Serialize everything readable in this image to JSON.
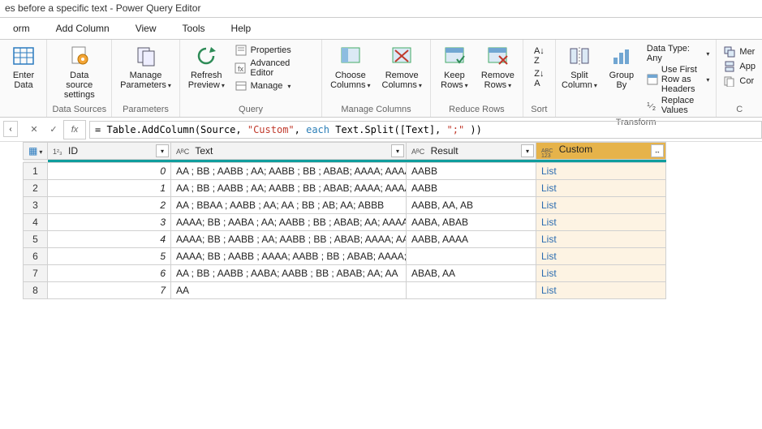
{
  "window": {
    "title": "es before a specific text - Power Query Editor"
  },
  "menus": [
    "orm",
    "Add Column",
    "View",
    "Tools",
    "Help"
  ],
  "ribbon": {
    "close": {
      "enter_data": "Enter\nData"
    },
    "data_sources": {
      "label": "Data Sources",
      "data_source_settings": "Data source\nsettings"
    },
    "parameters": {
      "label": "Parameters",
      "manage_parameters": "Manage\nParameters"
    },
    "query": {
      "label": "Query",
      "refresh_preview": "Refresh\nPreview",
      "properties": "Properties",
      "advanced_editor": "Advanced Editor",
      "manage": "Manage"
    },
    "manage_columns": {
      "label": "Manage Columns",
      "choose_columns": "Choose\nColumns",
      "remove_columns": "Remove\nColumns"
    },
    "reduce_rows": {
      "label": "Reduce Rows",
      "keep_rows": "Keep\nRows",
      "remove_rows": "Remove\nRows"
    },
    "sort": {
      "label": "Sort"
    },
    "transform": {
      "label": "Transform",
      "split_column": "Split\nColumn",
      "group_by": "Group\nBy",
      "data_type": "Data Type: Any",
      "first_row_headers": "Use First Row as Headers",
      "replace_values": "Replace Values"
    },
    "overflow": {
      "mer": "Mer",
      "app": "App",
      "cor": "Cor"
    }
  },
  "formula": {
    "prefix": "= Table.AddColumn(Source, ",
    "literal": "\"Custom\"",
    "mid1": ", ",
    "kw": "each",
    "mid2": " Text.Split([Text], ",
    "literal2": "\";\"",
    "suffix": " ))"
  },
  "grid": {
    "columns": {
      "id": "ID",
      "text": "Text",
      "result": "Result",
      "custom": "Custom"
    },
    "type_prefixes": {
      "id": "1²₃",
      "text": "AᴮC",
      "result": "AᴮC",
      "custom": "ABC\n123"
    },
    "rows": [
      {
        "n": "1",
        "id": "0",
        "text": "AA ; BB ; AABB ; AA; AABB ; BB ; ABAB; AAAA; AAAA",
        "result": "AABB",
        "custom": "List"
      },
      {
        "n": "2",
        "id": "1",
        "text": "AA ; BB ; AABB ; AA; AABB ; BB ; ABAB; AAAA; AAAA",
        "result": "AABB",
        "custom": "List"
      },
      {
        "n": "3",
        "id": "2",
        "text": "AA ; BBAA ; AABB ; AA; AA ; BB ; AB; AA; ABBB",
        "result": "AABB, AA, AB",
        "custom": "List"
      },
      {
        "n": "4",
        "id": "3",
        "text": "AAAA; BB ; AABA ; AA; AABB ; BB ; ABAB; AA; AAAA",
        "result": "AABA, ABAB",
        "custom": "List"
      },
      {
        "n": "5",
        "id": "4",
        "text": "AAAA; BB ; AABB ; AA; AABB ; BB ; ABAB; AAAA; AA",
        "result": "AABB, AAAA",
        "custom": "List"
      },
      {
        "n": "6",
        "id": "5",
        "text": "AAAA; BB ; AABB ; AAAA; AABB ; BB ; ABAB; AAAA; AABB",
        "result": "",
        "custom": "List"
      },
      {
        "n": "7",
        "id": "6",
        "text": "AA ; BB ; AABB ; AABA; AABB ; BB ; ABAB; AA; AA",
        "result": "ABAB, AA",
        "custom": "List"
      },
      {
        "n": "8",
        "id": "7",
        "text": "AA",
        "result": "",
        "custom": "List"
      }
    ]
  }
}
